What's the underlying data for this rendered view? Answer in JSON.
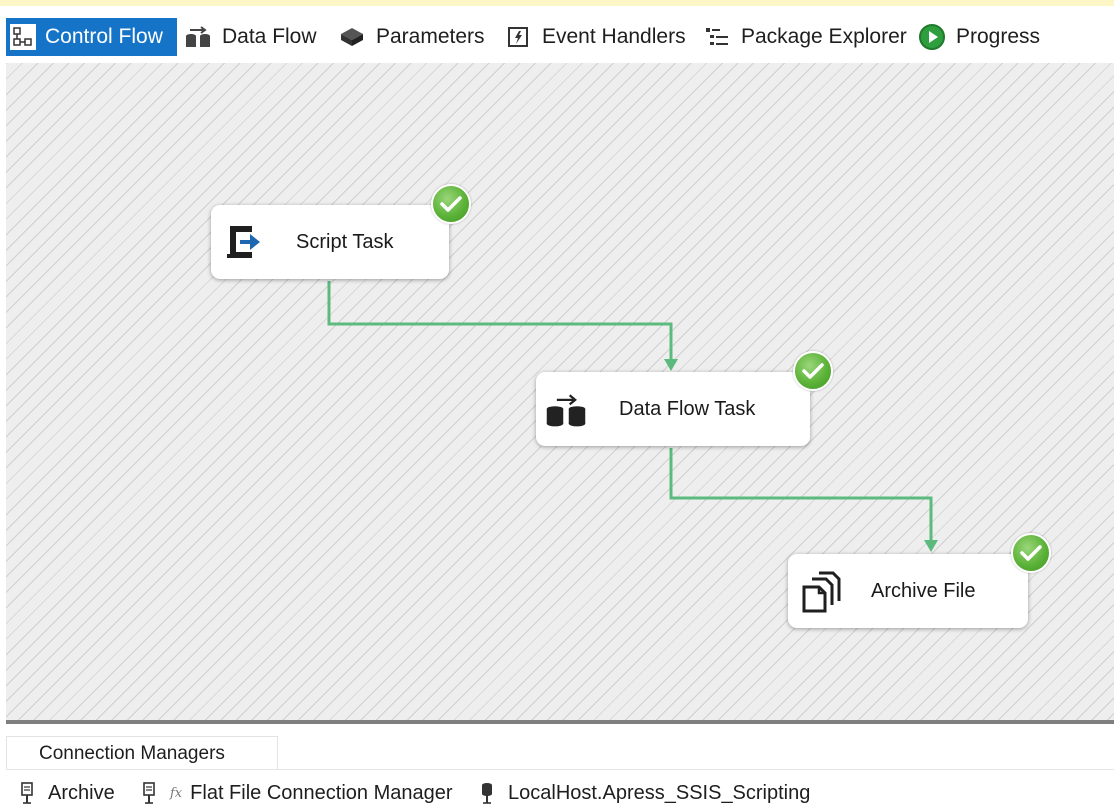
{
  "tabs": [
    {
      "label": "Control Flow",
      "icon": "control-flow-icon",
      "active": true
    },
    {
      "label": "Data Flow",
      "icon": "data-flow-icon",
      "active": false
    },
    {
      "label": "Parameters",
      "icon": "parameters-icon",
      "active": false
    },
    {
      "label": "Event Handlers",
      "icon": "event-handlers-icon",
      "active": false
    },
    {
      "label": "Package Explorer",
      "icon": "package-explorer-icon",
      "active": false
    },
    {
      "label": "Progress",
      "icon": "progress-icon",
      "active": false
    }
  ],
  "tasks": [
    {
      "label": "Script Task",
      "icon": "script-task-icon",
      "status": "success"
    },
    {
      "label": "Data Flow Task",
      "icon": "data-flow-task-icon",
      "status": "success"
    },
    {
      "label": "Archive File",
      "icon": "file-system-task-icon",
      "status": "success"
    }
  ],
  "connection_managers": {
    "tab_label": "Connection Managers",
    "items": [
      {
        "label": "Archive",
        "icon": "file-connection-icon"
      },
      {
        "label": "Flat File Connection Manager",
        "icon": "flat-file-connection-icon",
        "expression": "fx"
      },
      {
        "label": "LocalHost.Apress_SSIS_Scripting",
        "icon": "database-connection-icon"
      }
    ]
  },
  "colors": {
    "accent": "#1574c8",
    "connector": "#5dba7d",
    "success": "#5cb338"
  }
}
